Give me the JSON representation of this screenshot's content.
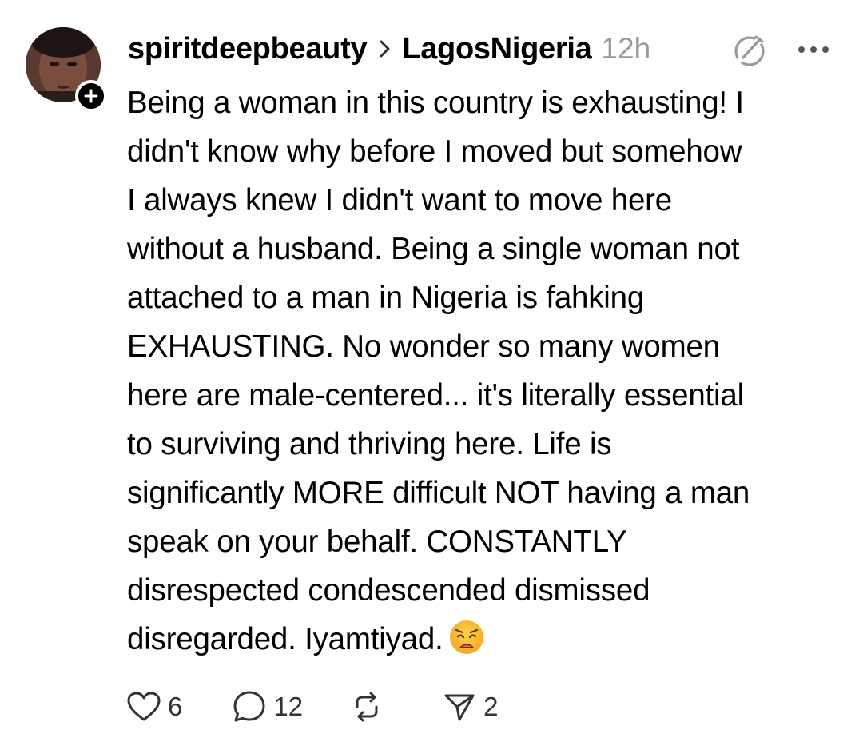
{
  "post": {
    "author": "spiritdeepbeauty",
    "community": "LagosNigeria",
    "time": "12h",
    "text_lines": [
      "Being a woman in this country is exhausting! I",
      "didn't know why before I moved but somehow",
      "I always knew I didn't want to move here",
      "without a husband. Being a single woman not",
      "attached to a man in Nigeria is fahking",
      "EXHAUSTING. No wonder so many women",
      "here are male-centered... it's literally essential",
      "to surviving and thriving here. Life is",
      "significantly MORE difficult NOT having a man",
      "speak on your behalf. CONSTANTLY",
      "disrespected condescended dismissed",
      "disregarded. Iyamtiyad."
    ],
    "emoji_icon": "weary-face-emoji"
  },
  "actions": {
    "like_count": "6",
    "reply_count": "12",
    "repost_count": "",
    "share_count": "2"
  },
  "icons": {
    "avatar": "profile-photo",
    "follow": "plus-icon",
    "chevron": "chevron-right-icon",
    "edit": "edit-pencil-circle-icon",
    "more": "more-horizontal-icon",
    "like": "heart-icon",
    "reply": "comment-bubble-icon",
    "repost": "repost-icon",
    "share": "send-icon"
  },
  "colors": {
    "text": "#000000",
    "muted": "#999999",
    "icon": "#333333",
    "background": "#ffffff"
  }
}
